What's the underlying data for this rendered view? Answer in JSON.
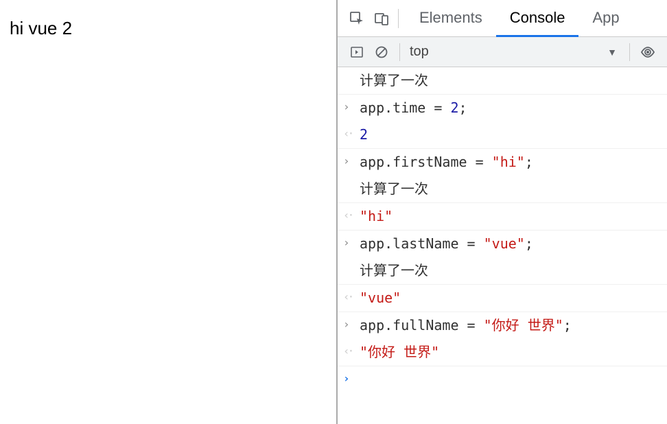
{
  "page": {
    "content": "hi vue 2"
  },
  "tabs": {
    "elements": "Elements",
    "console": "Console",
    "application": "App"
  },
  "toolbar": {
    "context": "top"
  },
  "console": {
    "rows": [
      {
        "type": "log",
        "text": "计算了一次"
      },
      {
        "type": "input",
        "tokens": [
          {
            "t": "app",
            "c": "tk-prop"
          },
          {
            "t": ".",
            "c": "tk-punc"
          },
          {
            "t": "time",
            "c": "tk-prop"
          },
          {
            "t": " = ",
            "c": "tk-punc"
          },
          {
            "t": "2",
            "c": "tk-num"
          },
          {
            "t": ";",
            "c": "tk-punc"
          }
        ]
      },
      {
        "type": "result",
        "value": "2",
        "class": "result-num"
      },
      {
        "type": "input",
        "tokens": [
          {
            "t": "app",
            "c": "tk-prop"
          },
          {
            "t": ".",
            "c": "tk-punc"
          },
          {
            "t": "firstName",
            "c": "tk-prop"
          },
          {
            "t": " = ",
            "c": "tk-punc"
          },
          {
            "t": "\"hi\"",
            "c": "tk-str"
          },
          {
            "t": ";",
            "c": "tk-punc"
          }
        ]
      },
      {
        "type": "log",
        "text": "计算了一次"
      },
      {
        "type": "result",
        "value": "\"hi\"",
        "class": "result-str"
      },
      {
        "type": "input",
        "tokens": [
          {
            "t": "app",
            "c": "tk-prop"
          },
          {
            "t": ".",
            "c": "tk-punc"
          },
          {
            "t": "lastName",
            "c": "tk-prop"
          },
          {
            "t": " = ",
            "c": "tk-punc"
          },
          {
            "t": "\"vue\"",
            "c": "tk-str"
          },
          {
            "t": ";",
            "c": "tk-punc"
          }
        ]
      },
      {
        "type": "log",
        "text": "计算了一次"
      },
      {
        "type": "result",
        "value": "\"vue\"",
        "class": "result-str"
      },
      {
        "type": "input",
        "tokens": [
          {
            "t": "app",
            "c": "tk-prop"
          },
          {
            "t": ".",
            "c": "tk-punc"
          },
          {
            "t": "fullName",
            "c": "tk-prop"
          },
          {
            "t": " = ",
            "c": "tk-punc"
          },
          {
            "t": "\"你好 世界\"",
            "c": "tk-str"
          },
          {
            "t": ";",
            "c": "tk-punc"
          }
        ]
      },
      {
        "type": "result",
        "value": "\"你好 世界\"",
        "class": "result-str"
      },
      {
        "type": "prompt"
      }
    ]
  }
}
